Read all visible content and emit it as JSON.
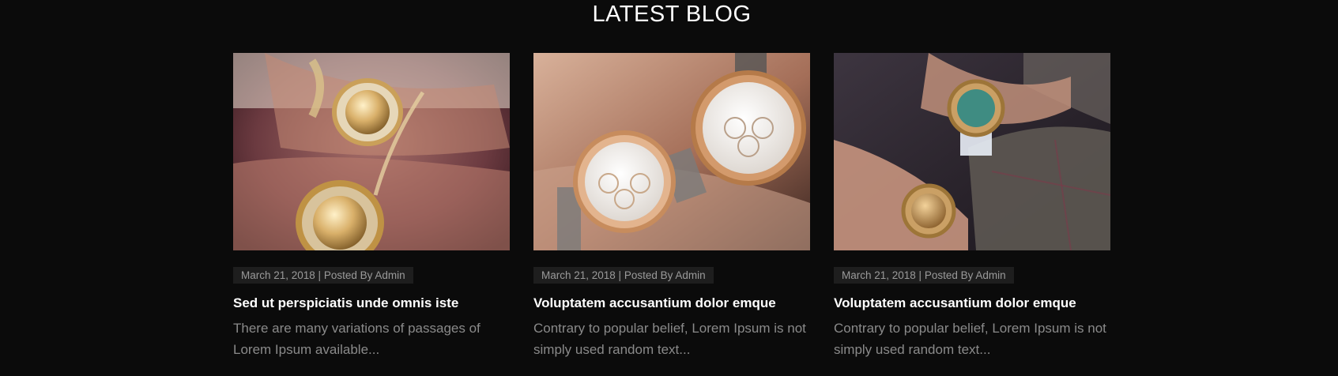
{
  "section": {
    "title": "LATEST BLOG"
  },
  "posts": [
    {
      "image_alt": "Stacked gold watches and bracelets on two wrists",
      "meta": "March 21, 2018 | Posted By Admin",
      "title": "Sed ut perspiciatis unde omnis iste",
      "excerpt": "There are many variations of passages of Lorem Ipsum available..."
    },
    {
      "image_alt": "Rose-gold watch with jeweled bezel and a second watch on wrist",
      "meta": "March 21, 2018 | Posted By Admin",
      "title": "Voluptatem accusantium dolor emque",
      "excerpt": "Contrary to popular belief, Lorem Ipsum is not simply used random text..."
    },
    {
      "image_alt": "Gold chronograph watches on wrists in a car",
      "meta": "March 21, 2018 | Posted By Admin",
      "title": "Voluptatem accusantium dolor emque",
      "excerpt": "Contrary to popular belief, Lorem Ipsum is not simply used random text..."
    }
  ]
}
